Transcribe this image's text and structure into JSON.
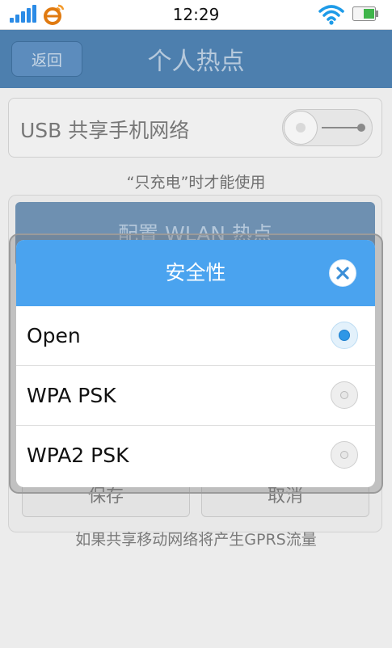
{
  "status_bar": {
    "time": "12:29"
  },
  "titlebar": {
    "back_label": "返回",
    "title": "个人热点"
  },
  "usb": {
    "label": "USB 共享手机网络",
    "note": "“只充电”时才能使用"
  },
  "wlan": {
    "header": "配置 WLAN 热点",
    "save_label": "保存",
    "cancel_label": "取消",
    "note": "如果共享移动网络将产生GPRS流量"
  },
  "dialog": {
    "title": "安全性",
    "options": [
      {
        "label": "Open",
        "selected": true
      },
      {
        "label": "WPA PSK",
        "selected": false
      },
      {
        "label": "WPA2 PSK",
        "selected": false
      }
    ]
  },
  "colors": {
    "dialog_header": "#4aa3ef",
    "titlebar": "#4d7fae",
    "signal": "#2b8be6",
    "battery_level": "#3fb54a"
  }
}
